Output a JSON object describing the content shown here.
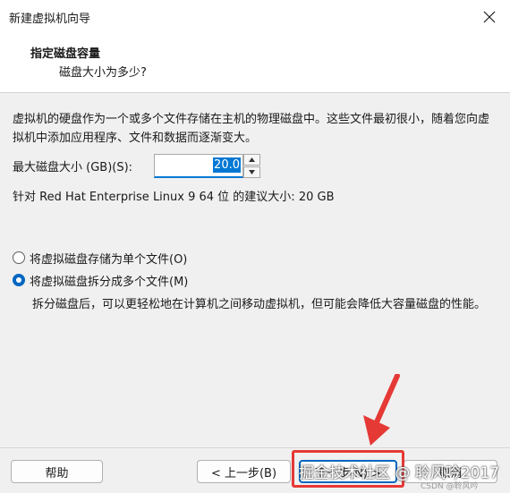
{
  "window": {
    "title": "新建虚拟机向导"
  },
  "header": {
    "title": "指定磁盘容量",
    "subtitle": "磁盘大小为多少?"
  },
  "description": "虚拟机的硬盘作为一个或多个文件存储在主机的物理磁盘中。这些文件最初很小，随着您向虚拟机中添加应用程序、文件和数据而逐渐变大。",
  "disk_size": {
    "label": "最大磁盘大小 (GB)(S):",
    "value": "20.0"
  },
  "recommended": "针对 Red Hat Enterprise Linux 9 64 位 的建议大小: 20 GB",
  "options": [
    {
      "label": "将虚拟磁盘存储为单个文件(O)",
      "selected": false
    },
    {
      "label": "将虚拟磁盘拆分成多个文件(M)",
      "selected": true
    }
  ],
  "split_note": "拆分磁盘后，可以更轻松地在计算机之间移动虚拟机，但可能会降低大容量磁盘的性能。",
  "buttons": {
    "help": "帮助",
    "back": "< 上一步(B)",
    "next": "下一步(N) >",
    "cancel": "取消"
  },
  "watermark": {
    "main": "掘金技术社区 @ 聆风吟2017",
    "small": "CSDN @聆风吟"
  },
  "colors": {
    "accent": "#0067c0",
    "annotation": "#e53935"
  }
}
